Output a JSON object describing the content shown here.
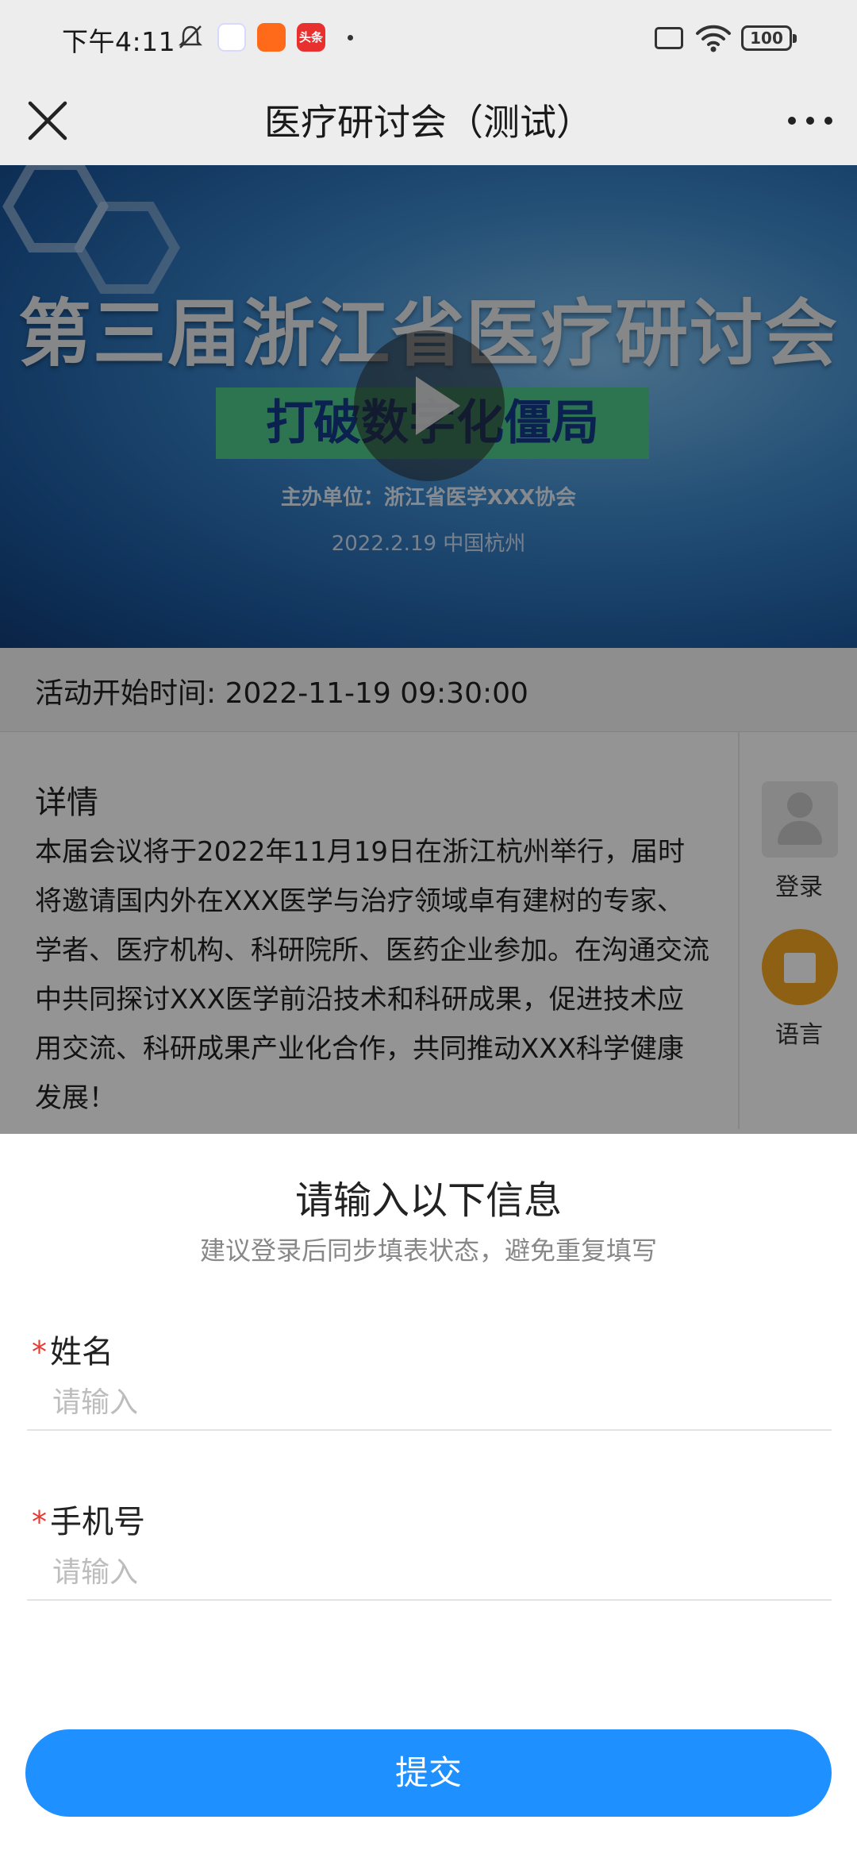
{
  "status_bar": {
    "time": "下午4:11",
    "toutiao_label": "头条",
    "battery": "100"
  },
  "nav": {
    "title": "医疗研讨会（测试）"
  },
  "banner": {
    "title": "第三届浙江省医疗研讨会",
    "subtitle": "打破数字化僵局",
    "organizer": "主办单位：浙江省医学XXX协会",
    "date_place": "2022.2.19  中国杭州"
  },
  "event": {
    "start_time": "活动开始时间: 2022-11-19 09:30:00",
    "details_heading": "详情",
    "details_body": "本届会议将于2022年11月19日在浙江杭州举行，届时将邀请国内外在XXX医学与治疗领域卓有建树的专家、学者、医疗机构、科研院所、医药企业参加。在沟通交流中共同探讨XXX医学前沿技术和科研成果，促进技术应用交流、科研成果产业化合作，共同推动XXX科学健康发展！"
  },
  "side": {
    "login_label": "登录",
    "language_label": "语言"
  },
  "form": {
    "title": "请输入以下信息",
    "subtitle": "建议登录后同步填表状态，避免重复填写",
    "required_mark": "*",
    "name_label": "姓名",
    "name_placeholder": "请输入",
    "phone_label": "手机号",
    "phone_placeholder": "请输入",
    "submit_label": "提交"
  },
  "colors": {
    "primary": "#1e90ff",
    "required": "#e8382f",
    "nav_bg": "#ededed"
  }
}
